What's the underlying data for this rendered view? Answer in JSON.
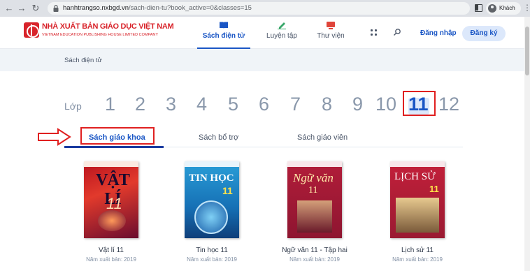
{
  "browser": {
    "url_host": "hanhtrangso.nxbgd.vn",
    "url_path": "/sach-dien-tu?book_active=0&classes=15",
    "profile_label": "Khách"
  },
  "header": {
    "logo_title": "NHÀ XUẤT BẢN GIÁO DỤC VIỆT NAM",
    "logo_subtitle": "VIETNAM EDUCATION PUBLISHING HOUSE LIMITED COMPANY",
    "nav": [
      {
        "label": "Sách điện tử",
        "active": true
      },
      {
        "label": "Luyện tập",
        "active": false
      },
      {
        "label": "Thư viện",
        "active": false
      }
    ],
    "login": "Đăng nhập",
    "register": "Đăng ký"
  },
  "breadcrumb": "Sách điện tử",
  "grades": {
    "label": "Lớp",
    "items": [
      "1",
      "2",
      "3",
      "4",
      "5",
      "6",
      "7",
      "8",
      "9",
      "10",
      "11",
      "12"
    ],
    "selected": "11"
  },
  "categories": [
    {
      "label": "Sách giáo khoa",
      "active": true
    },
    {
      "label": "Sách bổ trợ",
      "active": false
    },
    {
      "label": "Sách giáo viên",
      "active": false
    }
  ],
  "books": [
    {
      "title": "Vật lí 11",
      "year_label": "Năm xuất bản:",
      "year": "2019",
      "cover_text": "VẬT LÍ",
      "cover_num": "11"
    },
    {
      "title": "Tin học 11",
      "year_label": "Năm xuất bản:",
      "year": "2019",
      "cover_text": "TIN HỌC",
      "cover_num": "11"
    },
    {
      "title": "Ngữ văn 11 - Tập hai",
      "year_label": "Năm xuất bản:",
      "year": "2019",
      "cover_text": "Ngữ văn",
      "cover_num": "11"
    },
    {
      "title": "Lịch sử 11",
      "year_label": "Năm xuất bản:",
      "year": "2019",
      "cover_text": "LỊCH SỬ",
      "cover_num": "11"
    }
  ],
  "colors": {
    "accent": "#1a56c5",
    "highlight": "#e02020",
    "brand": "#d8232a"
  }
}
